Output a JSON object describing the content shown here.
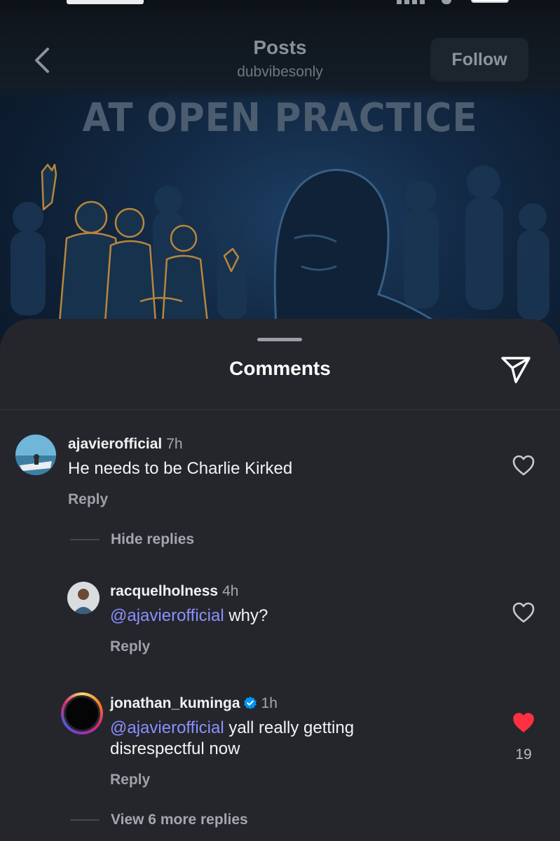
{
  "header": {
    "title": "Posts",
    "subtitle": "dubvibesonly",
    "follow_label": "Follow"
  },
  "post": {
    "headline": "AT OPEN PRACTICE"
  },
  "sheet": {
    "title": "Comments"
  },
  "comments": [
    {
      "username": "ajavierofficial",
      "time": "7h",
      "text": "He needs to be Charlie Kirked",
      "reply_label": "Reply",
      "thread_toggle": "Hide replies"
    }
  ],
  "replies": [
    {
      "username": "racquelholness",
      "time": "4h",
      "mention": "@ajavierofficial",
      "text": " why?",
      "reply_label": "Reply",
      "liked": false
    },
    {
      "username": "jonathan_kuminga",
      "time": "1h",
      "verified": true,
      "mention": "@ajavierofficial",
      "text": " yall really getting disrespectful now",
      "reply_label": "Reply",
      "liked": true,
      "like_count": "19"
    }
  ],
  "more_replies_label": "View 6 more replies",
  "colors": {
    "sheet_bg": "#24262b",
    "mention": "#8b90ff",
    "like_active": "#ff3040",
    "verified": "#0095f6"
  }
}
